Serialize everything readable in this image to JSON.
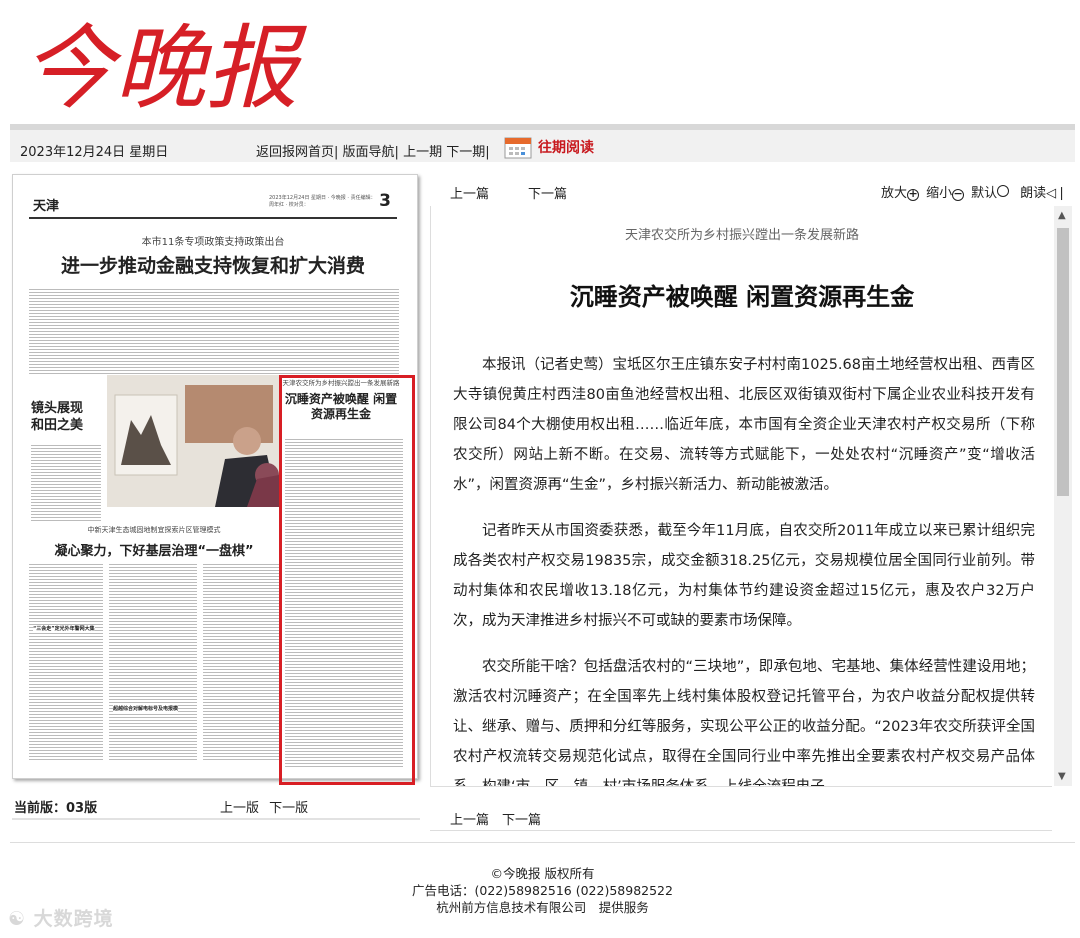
{
  "masthead": {
    "title": "今晚报",
    "color": "#d61f26"
  },
  "topbar": {
    "date": "2023年12月24日 星期日",
    "links": [
      "返回报网首页|",
      "版面导航|",
      "上一期",
      "下一期|"
    ],
    "past_reading": "往期阅读"
  },
  "newspaper": {
    "page_header_left": "天津",
    "page_number": "3",
    "header_meta": "2023年12月24日 星期日 · 今晚报 · 责任编辑：周年红 · 校对员：",
    "lead_kicker": "本市11条专项政策支持政策出台",
    "lead_headline": "进一步推动金融支持恢复和扩大消费",
    "photo_headline": "镜头展现和田之美",
    "article_kicker": "天津农交所为乡村振兴蹚出一条发展新路",
    "article_headline": "沉睡资产被唤醒 闲置资源再生金",
    "bottom_kicker": "中新天津生态城固地制宜探索片区管理模式",
    "bottom_headline": "凝心聚力，下好基层治理“一盘棋”",
    "sub_head_1": "“三会走”定光外年警网大集",
    "sub_head_2": "超越综合对解电标号及电报模"
  },
  "version_nav": {
    "current": "当前版：03版",
    "prev": "上一版",
    "next": "下一版"
  },
  "article_nav": {
    "prev": "上一篇",
    "next": "下一篇"
  },
  "tools": {
    "zoom_in": "放大",
    "zoom_out": "缩小",
    "default": "默认",
    "read": "朗读"
  },
  "article": {
    "kicker": "天津农交所为乡村振兴蹚出一条发展新路",
    "headline": "沉睡资产被唤醒 闲置资源再生金",
    "paragraphs": [
      "本报讯（记者史莺）宝坻区尔王庄镇东安子村村南1025.68亩土地经营权出租、西青区大寺镇倪黄庄村西洼80亩鱼池经营权出租、北辰区双街镇双街村下属企业农业科技开发有限公司84个大棚使用权出租……临近年底，本市国有全资企业天津农村产权交易所（下称农交所）网站上新不断。在交易、流转等方式赋能下，一处处农村“沉睡资产”变“增收活水”，闲置资源再“生金”，乡村振兴新活力、新动能被激活。",
      "记者昨天从市国资委获悉，截至今年11月底，自农交所2011年成立以来已累计组织完成各类农村产权交易19835宗，成交金额318.25亿元，交易规模位居全国同行业前列。带动村集体和农民增收13.18亿元，为村集体节约建设资金超过15亿元，惠及农户32万户次，成为天津推进乡村振兴不可或缺的要素市场保障。",
      "农交所能干啥？包括盘活农村的“三块地”，即承包地、宅基地、集体经营性建设用地；激活农村沉睡资产；在全国率先上线村集体股权登记托管平台，为农户收益分配权提供转让、继承、赠与、质押和分红等服务，实现公平公正的收益分配。“2023年农交所获评全国农村产权流转交易规范化试点，取得在全国同行业中率先推出全要素农村产权交易产品体系、构建‘市—区—镇—村’市场服务体系、上线全流程电子"
    ]
  },
  "footer": {
    "copyright": "©今晚报 版权所有",
    "ad_phone": "广告电话：(022)58982516 (022)58982522",
    "provider": "杭州前方信息技术有限公司　提供服务"
  },
  "watermark": "大数跨境"
}
